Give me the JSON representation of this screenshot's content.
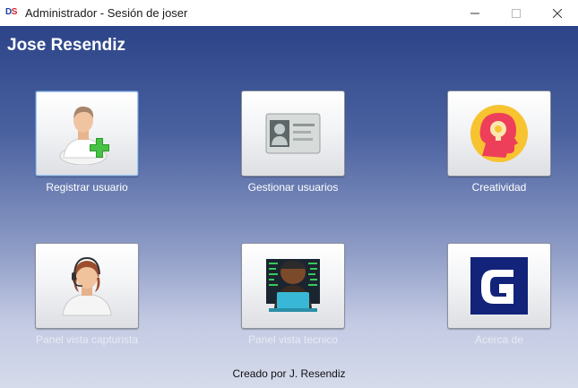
{
  "window": {
    "title": "Administrador - Sesión de joser",
    "logo_d": "D",
    "logo_s": "S",
    "controls": [
      "minimize-icon",
      "maximize-icon",
      "close-icon"
    ]
  },
  "header": {
    "user_name": "Jose Resendiz"
  },
  "tiles": [
    {
      "label": "Registrar usuario",
      "icon": "add-user-icon"
    },
    {
      "label": "Gestionar usuarios",
      "icon": "id-card-icon"
    },
    {
      "label": "Creatividad",
      "icon": "creativity-head-icon"
    },
    {
      "label": "Panel vista capturista",
      "icon": "operator-headset-icon"
    },
    {
      "label": "Panel vista tecnico",
      "icon": "technician-icon"
    },
    {
      "label": "Acerca de",
      "icon": "about-logo-icon"
    }
  ],
  "footer": {
    "credit": "Creado por J. Resendiz"
  },
  "colors": {
    "gradient_top": "#2c4488",
    "gradient_bottom": "#d6dbeb",
    "logo_blue": "#1d3fa0",
    "logo_red": "#d8202a"
  }
}
